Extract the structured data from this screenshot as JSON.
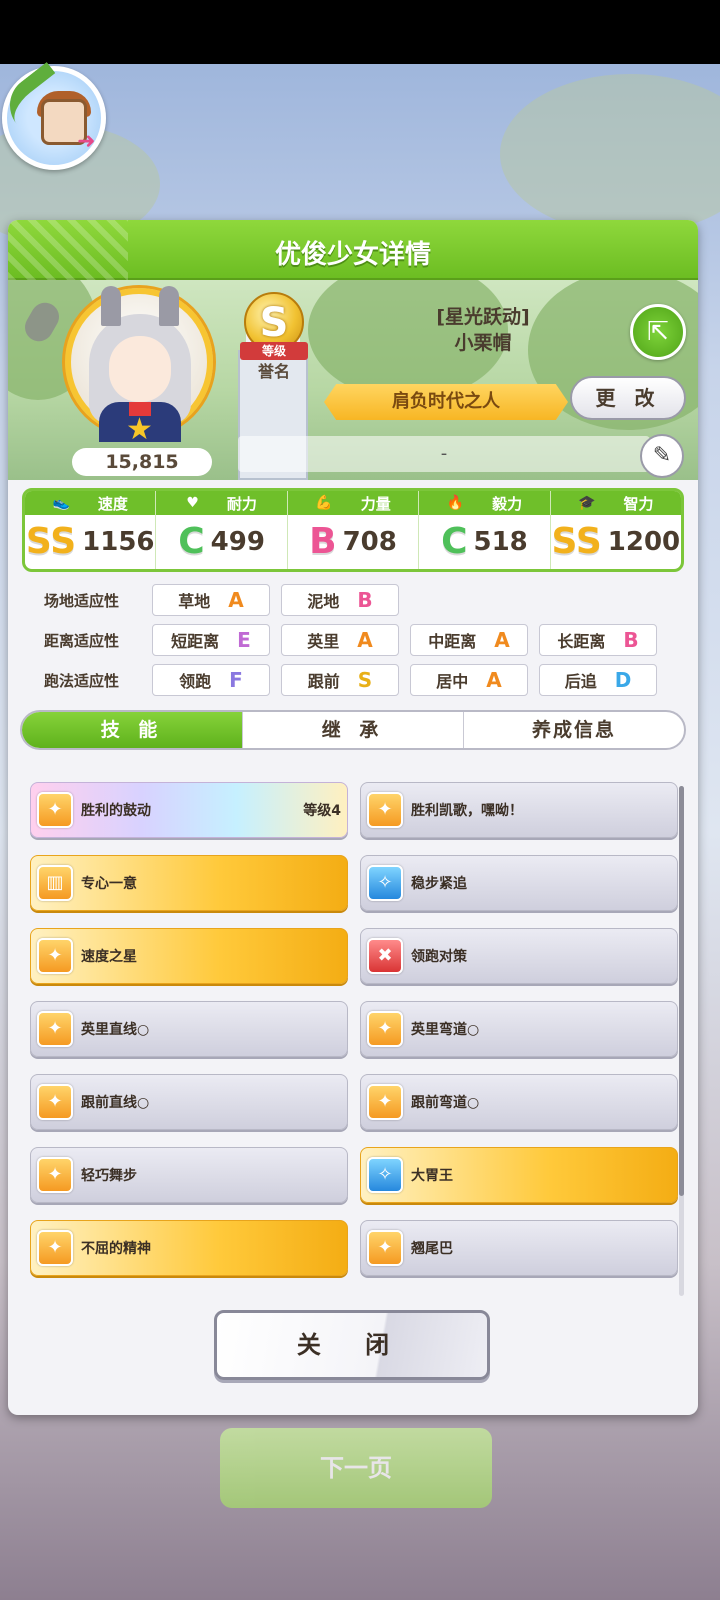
{
  "dialog": {
    "title": "优俊少女详情"
  },
  "translator": {
    "icon": "translator-badge-icon"
  },
  "character": {
    "name_line1": "[星光跃动]",
    "name_line2": "小栗帽",
    "fans": "15,815",
    "rank_letter": "S",
    "rank_ribbon": "等级",
    "rank_caption": "誉名",
    "title": "肩负时代之人",
    "change_label": "更 改",
    "comment": "-"
  },
  "stats": [
    {
      "label": "速度",
      "grade": "SS",
      "value": "1156",
      "cls": "ss"
    },
    {
      "label": "耐力",
      "grade": "C",
      "value": "499",
      "cls": "c"
    },
    {
      "label": "力量",
      "grade": "B",
      "value": "708",
      "cls": "b"
    },
    {
      "label": "毅力",
      "grade": "C",
      "value": "518",
      "cls": "c"
    },
    {
      "label": "智力",
      "grade": "SS",
      "value": "1200",
      "cls": "ss"
    }
  ],
  "aptitude": {
    "field": {
      "label": "场地适应性",
      "items": [
        {
          "name": "草地",
          "grade": "A"
        },
        {
          "name": "泥地",
          "grade": "B"
        }
      ]
    },
    "distance": {
      "label": "距离适应性",
      "items": [
        {
          "name": "短距离",
          "grade": "E"
        },
        {
          "name": "英里",
          "grade": "A"
        },
        {
          "name": "中距离",
          "grade": "A"
        },
        {
          "name": "长距离",
          "grade": "B"
        }
      ]
    },
    "style": {
      "label": "跑法适应性",
      "items": [
        {
          "name": "领跑",
          "grade": "F"
        },
        {
          "name": "跟前",
          "grade": "S"
        },
        {
          "name": "居中",
          "grade": "A"
        },
        {
          "name": "后追",
          "grade": "D"
        }
      ]
    }
  },
  "tabs": [
    "技 能",
    "继 承",
    "养成信息"
  ],
  "skills": [
    {
      "name": "胜利的鼓动",
      "level": "等级4",
      "style": "rainbow",
      "icon": "speed-horse-icon"
    },
    {
      "name": "胜利凯歌，嘿呦！",
      "style": "silver",
      "icon": "speed-horse-icon"
    },
    {
      "name": "专心一意",
      "style": "gold",
      "icon": "gate-icon"
    },
    {
      "name": "稳步紧追",
      "style": "silver",
      "icon": "sparkle-blue-icon"
    },
    {
      "name": "速度之星",
      "style": "gold",
      "icon": "speed-horse-icon"
    },
    {
      "name": "领跑对策",
      "style": "silver",
      "icon": "debuff-red-icon"
    },
    {
      "name": "英里直线○",
      "style": "silver",
      "icon": "speed-horse-icon"
    },
    {
      "name": "英里弯道○",
      "style": "silver",
      "icon": "speed-horse-icon"
    },
    {
      "name": "跟前直线○",
      "style": "silver",
      "icon": "speed-horse-icon"
    },
    {
      "name": "跟前弯道○",
      "style": "silver",
      "icon": "speed-horse-icon"
    },
    {
      "name": "轻巧舞步",
      "style": "silver",
      "icon": "speed-horse-icon"
    },
    {
      "name": "大胃王",
      "style": "gold",
      "icon": "sparkle-blue-icon"
    },
    {
      "name": "不屈的精神",
      "style": "gold",
      "icon": "speed-horse-icon"
    },
    {
      "name": "翘尾巴",
      "style": "silver",
      "icon": "speed-horse-icon"
    }
  ],
  "buttons": {
    "close": "关 闭",
    "next": "下一页"
  }
}
